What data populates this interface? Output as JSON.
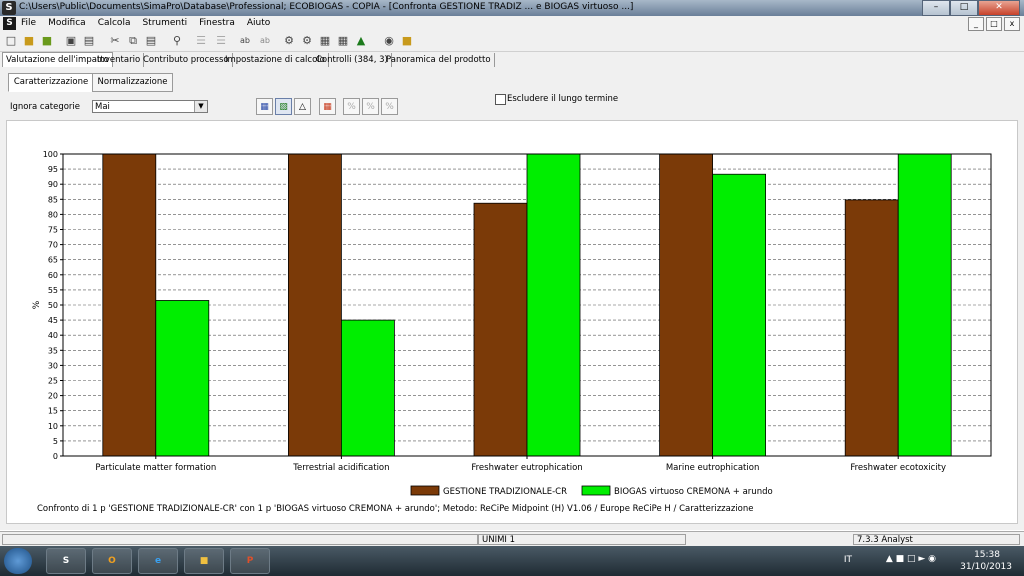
{
  "window": {
    "title": "C:\\Users\\Public\\Documents\\SimaPro\\Database\\Professional; ECOBIOGAS - COPIA - [Confronta GESTIONE TRADIZ ... e BIOGAS virtuoso ...]",
    "app_icon": "S"
  },
  "menu": {
    "items": [
      "File",
      "Modifica",
      "Calcola",
      "Strumenti",
      "Finestra",
      "Aiuto"
    ]
  },
  "tabs": [
    "Valutazione dell'impatto",
    "Inventario",
    "Contributo processo",
    "Impostazione di calcolo",
    "Controlli (384, 3)",
    "Panoramica del prodotto"
  ],
  "subtabs": [
    "Caratterizzazione",
    "Normalizzazione"
  ],
  "controls": {
    "ignora_label": "Ignora categorie",
    "ignora_value": "Mai",
    "escludere_label": "Escludere il lungo termine"
  },
  "chart_data": {
    "type": "bar",
    "categories": [
      "Particulate matter formation",
      "Terrestrial acidification",
      "Freshwater eutrophication",
      "Marine eutrophication",
      "Freshwater ecotoxicity"
    ],
    "series": [
      {
        "name": "GESTIONE TRADIZIONALE-CR",
        "values": [
          100,
          100,
          83.7,
          100,
          84.8
        ],
        "color": "#7b3a08"
      },
      {
        "name": "BIOGAS virtuoso CREMONA + arundo",
        "values": [
          51.5,
          45,
          100,
          93.3,
          100
        ],
        "color": "#00ee00"
      }
    ],
    "ylabel": "%",
    "ylim": [
      0,
      100
    ],
    "yticks": [
      0,
      5,
      10,
      15,
      20,
      25,
      30,
      35,
      40,
      45,
      50,
      55,
      60,
      65,
      70,
      75,
      80,
      85,
      90,
      95,
      100
    ],
    "grid": true,
    "legend": "bottom"
  },
  "footer_text": "Confronto di 1 p 'GESTIONE TRADIZIONALE-CR' con 1 p 'BIOGAS virtuoso CREMONA + arundo';  Metodo: ReCiPe Midpoint (H) V1.06 / Europe ReCiPe H / Caratterizzazione",
  "status": {
    "center": "UNIMI 1",
    "right": "7.3.3 Analyst"
  },
  "tray": {
    "lang": "IT",
    "time": "15:38",
    "date": "31/10/2013"
  }
}
